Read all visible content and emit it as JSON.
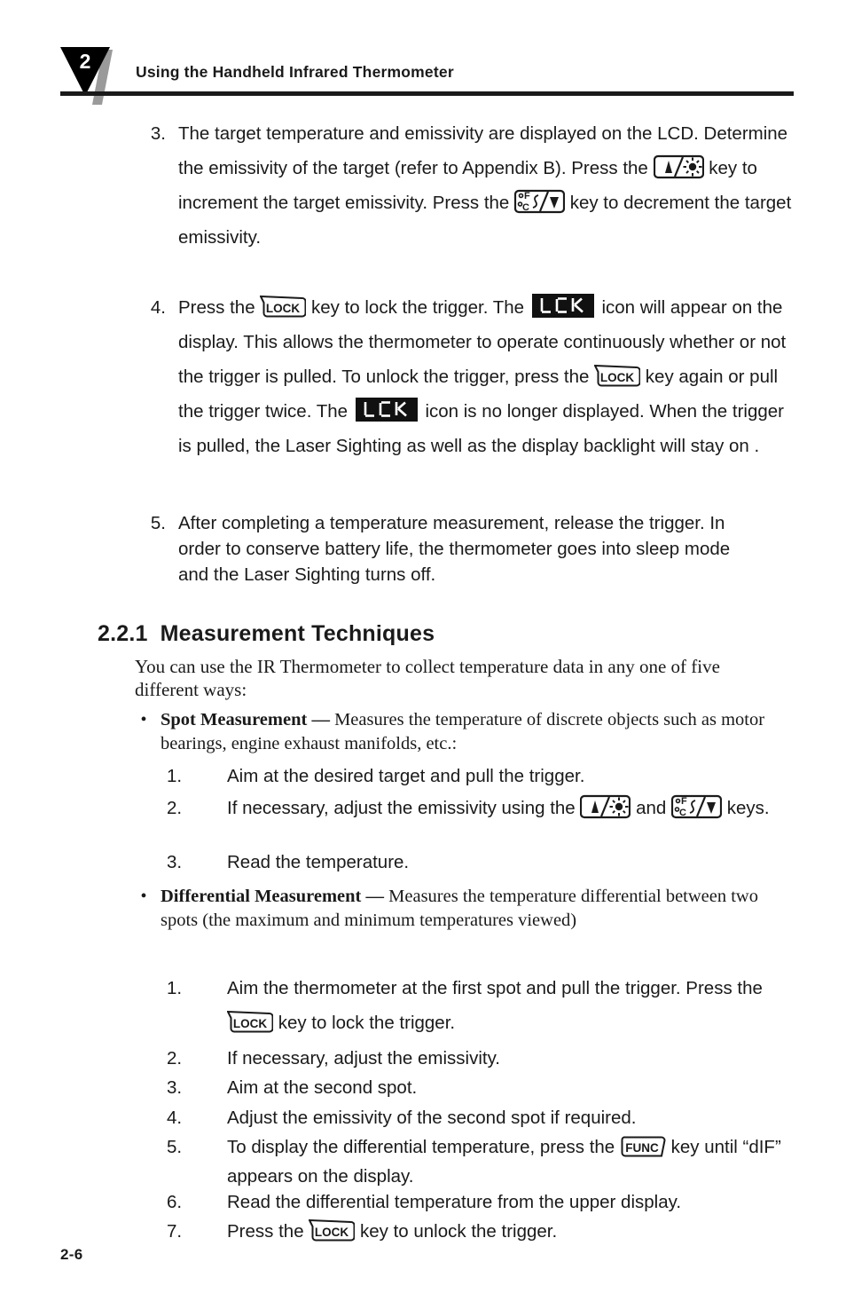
{
  "page": {
    "number_label": "2-6",
    "chapter_number": "2",
    "running_header": "Using the Handheld Infrared Thermometer"
  },
  "colors": {
    "ink": "#1a1a1a",
    "badge_fill": "#000000",
    "badge_accent": "#9a9a9a",
    "lcd_background": "#111111",
    "lcd_segment": "#ffffff",
    "paper": "#ffffff"
  },
  "icons": {
    "increment_key": "up-arrow-sun-key-icon",
    "decrement_key": "celsius-fahrenheit-down-key-icon",
    "lock_key": "lock-key-icon",
    "func_key": "func-key-icon",
    "lck_display": "lck-lcd-icon"
  },
  "icon_labels": {
    "lock": "LOCK",
    "func": "FUNC",
    "lck": "LCK",
    "celsius": "C",
    "fahrenheit": "F"
  },
  "steps": [
    {
      "num": "3.",
      "segments": [
        "The target temperature and emissivity are displayed on the LCD. Determine the emissivity of the target (refer to Appendix B). Press the ",
        " key to increment the target emissivity. Press the ",
        " key to decrement the target emissivity."
      ]
    },
    {
      "num": "4.",
      "segments": [
        "Press the ",
        " key to lock the trigger. The ",
        " icon will appear on the display. This allows the thermometer to operate continuously whether or not the trigger is pulled. To unlock the trigger, press the ",
        " key again or pull the trigger twice. The ",
        " icon is no longer displayed. When the trigger is pulled, the Laser Sighting as well as the display backlight will stay on ."
      ]
    },
    {
      "num": "5.",
      "segments": [
        "After completing a temperature measurement, release the trigger. In order to conserve battery life, the thermometer goes into sleep mode and the Laser Sighting turns off."
      ]
    }
  ],
  "section": {
    "number": "2.2.1",
    "title": "Measurement Techniques",
    "intro": "You can use the IR Thermometer to collect temperature data in any one of five different ways:"
  },
  "bullets": [
    {
      "marker": "•",
      "term": "Spot Measurement",
      "dash": " — ",
      "text": "Measures the temperature of discrete objects such as motor bearings, engine exhaust manifolds, etc.:"
    },
    {
      "marker": "•",
      "term": "Differential Measurement",
      "dash": " — ",
      "text": "Measures the temperature differential between two spots (the maximum and minimum temperatures viewed)"
    }
  ],
  "spot_steps": [
    {
      "num": "1.",
      "segments": [
        "Aim at the desired target and pull the trigger."
      ]
    },
    {
      "num": "2.",
      "segments": [
        "If necessary, adjust the emissivity using the ",
        " and ",
        " keys."
      ]
    },
    {
      "num": "3.",
      "segments": [
        "Read the temperature."
      ]
    }
  ],
  "differential_steps": [
    {
      "num": "1.",
      "segments": [
        "Aim the thermometer at the first spot and pull the trigger. Press the ",
        " key to lock the trigger."
      ]
    },
    {
      "num": "2.",
      "segments": [
        "If necessary, adjust the emissivity."
      ]
    },
    {
      "num": "3.",
      "segments": [
        "Aim at the second spot."
      ]
    },
    {
      "num": "4.",
      "segments": [
        "Adjust the emissivity of the second spot if required."
      ]
    },
    {
      "num": "5.",
      "segments": [
        "To display the differential temperature, press the ",
        " key until “dIF” appears on the display."
      ]
    },
    {
      "num": "6.",
      "segments": [
        "Read the differential temperature from the upper display."
      ]
    },
    {
      "num": "7.",
      "segments": [
        "Press the ",
        " key to unlock the trigger."
      ]
    }
  ]
}
